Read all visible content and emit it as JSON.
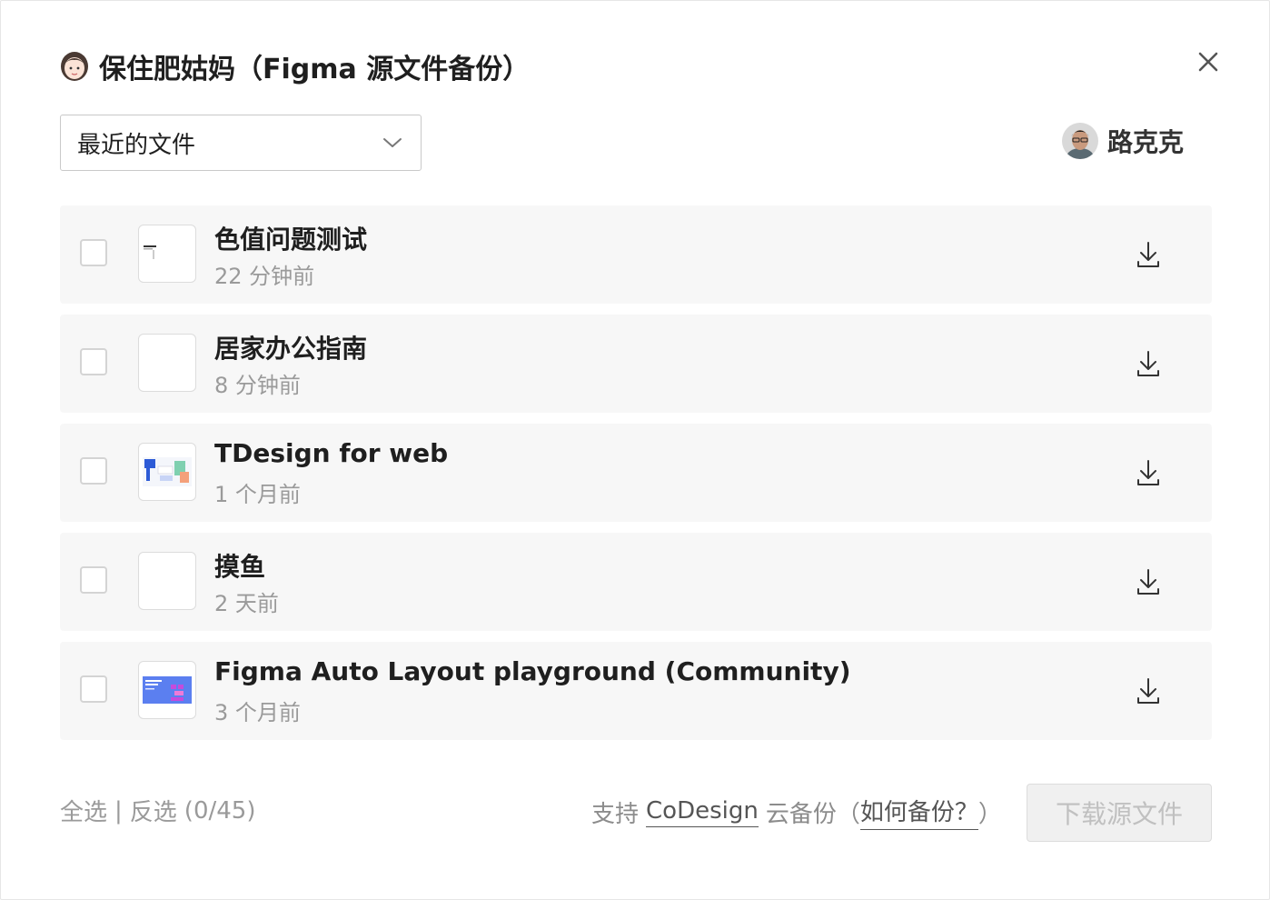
{
  "dialog": {
    "title": "保住肥姑妈（Figma 源文件备份）",
    "close_icon": "close-icon",
    "title_icon": "woman-face-icon"
  },
  "filter": {
    "selected": "最近的文件",
    "icon": "chevron-down-icon"
  },
  "user": {
    "name": "路克克",
    "avatar_icon": "user-avatar"
  },
  "files": [
    {
      "name": "色值问题测试",
      "time": "22 分钟前",
      "thumb": "color-test-thumbnail"
    },
    {
      "name": "居家办公指南",
      "time": "8 分钟前",
      "thumb": "blank-thumbnail"
    },
    {
      "name": "TDesign for web",
      "time": "1 个月前",
      "thumb": "tdesign-thumbnail"
    },
    {
      "name": "摸鱼",
      "time": "2 天前",
      "thumb": "blank-thumbnail"
    },
    {
      "name": "Figma Auto Layout playground (Community)",
      "time": "3 个月前",
      "thumb": "auto-layout-thumbnail"
    }
  ],
  "footer": {
    "select_all": "全选",
    "separator": "|",
    "invert_select": "反选",
    "count": "(0/45)",
    "support_prefix": "支持",
    "codesign_link": "CoDesign",
    "support_suffix": "云备份（",
    "howto_link": "如何备份？",
    "close_paren": "）",
    "download_button": "下载源文件"
  },
  "colors": {
    "row_bg": "#f7f7f7",
    "muted_text": "#9a9a9a",
    "disabled_button_bg": "#f0f0f0"
  }
}
